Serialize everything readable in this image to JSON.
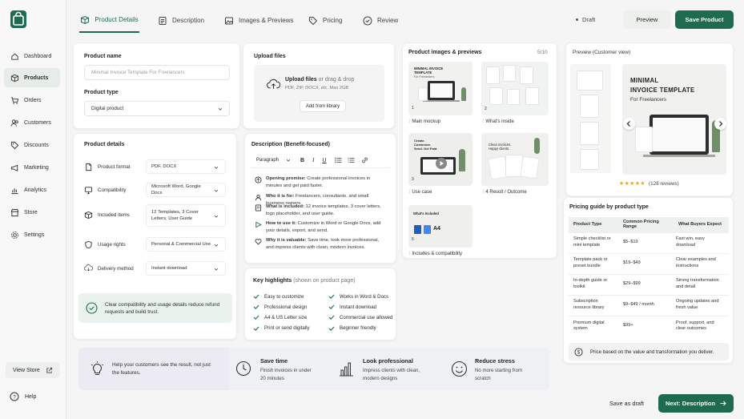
{
  "sidebar": {
    "items": [
      {
        "label": "Dashboard",
        "icon": "home-icon"
      },
      {
        "label": "Products",
        "icon": "box-icon",
        "active": true
      },
      {
        "label": "Orders",
        "icon": "cart-icon"
      },
      {
        "label": "Customers",
        "icon": "users-icon"
      },
      {
        "label": "Discounts",
        "icon": "tag-icon"
      },
      {
        "label": "Marketing",
        "icon": "megaphone-icon"
      },
      {
        "label": "Analytics",
        "icon": "chart-icon"
      },
      {
        "label": "Store",
        "icon": "store-icon"
      },
      {
        "label": "Settings",
        "icon": "gear-icon"
      }
    ],
    "view_store": "View Store",
    "help": "Help"
  },
  "tabs": [
    "Product Details",
    "Description",
    "Images & Previews",
    "Pricing",
    "Review"
  ],
  "status": "Draft",
  "preview_button": "Preview",
  "save_button": "Save Product",
  "product": {
    "name_label": "Product name",
    "name_placeholder": "Minimal Invoice Template For Freelancers",
    "type_label": "Product type",
    "type_value": "Digital product"
  },
  "upload": {
    "title": "Upload files",
    "main": "Upload files",
    "or": "or drag & drop",
    "formats": "PDF, ZIP, DOCX, etc. Max 2GB",
    "library_button": "Add from library"
  },
  "details": {
    "title": "Product details",
    "rows": [
      {
        "label": "Product format",
        "value": "PDF, DOCX"
      },
      {
        "label": "Compatibility",
        "value": "Microsoft Word, Google Docs"
      },
      {
        "label": "Included items",
        "value": "12 Templates, 3 Cover Letters, User Guide"
      },
      {
        "label": "Usage rights",
        "value": "Personal & Commercial Use"
      },
      {
        "label": "Delivery method",
        "value": "Instant download"
      }
    ],
    "note": "Clear compatibility and usage details reduce refund requests and build trust."
  },
  "description": {
    "title": "Description (Benefit-focused)",
    "style": "Paragraph",
    "items": [
      {
        "bold": "Opening promise:",
        "text": "Create professional invoices in minutes and get paid faster."
      },
      {
        "bold": "Who it is for:",
        "text": "Freelancers, consultants, and small business owners."
      },
      {
        "bold": "What is included:",
        "text": "12 invoice templates, 3 cover letters, logo placeholder, and user guide."
      },
      {
        "bold": "How to use it:",
        "text": "Customize in Word or Google Docs, add your details, export, and send."
      },
      {
        "bold": "Why it is valuable:",
        "text": "Save time, look more professional, and impress clients with clean, modern invoices."
      }
    ]
  },
  "highlights": {
    "title": "Key highlights",
    "subtitle": "(shown on product page)",
    "items": [
      "Easy to customize",
      "Works in Word & Docs",
      "Professional design",
      "Instant download",
      "A4 & US Letter size",
      "Commercial use allowed",
      "Print or send digitally",
      "Beginner friendly"
    ]
  },
  "images": {
    "title": "Product images & previews",
    "count": "5/10",
    "tiles": [
      {
        "num": "1",
        "caption": "Main mockup",
        "heading": "MINIMAL INVOICE TEMPLATE",
        "sub": "For Freelancers"
      },
      {
        "num": "2",
        "caption": "What's inside"
      },
      {
        "num": "3",
        "caption": "Use case",
        "heading": "Create. Customize. Send. Get Paid."
      },
      {
        "num": "4",
        "caption": "Result / Outcome",
        "heading": "Clean invoices. Happy clients."
      },
      {
        "num": "5",
        "caption": "Includes & compatibility",
        "heading": "What's Included"
      }
    ]
  },
  "preview": {
    "title": "Preview (Customer view)",
    "heading1": "MINIMAL",
    "heading2": "INVOICE TEMPLATE",
    "sub": "For Freelancers",
    "reviews": "(128 reviews)",
    "rating": 4.5
  },
  "pricing": {
    "title": "Pricing guide by product type",
    "headers": [
      "Product Type",
      "Common Pricing Range",
      "What Buyers Expect"
    ],
    "rows": [
      [
        "Simple checklist or mini template",
        "$5–$19",
        "Fast win, easy download"
      ],
      [
        "Template pack or preset bundle",
        "$19–$49",
        "Clear examples and instructions"
      ],
      [
        "In-depth guide or toolkit",
        "$29–$99",
        "Strong transformation and detail"
      ],
      [
        "Subscription resource library",
        "$9–$49 / month",
        "Ongoing updates and fresh value"
      ],
      [
        "Premium digital system",
        "$99+",
        "Proof, support, and clear outcomes"
      ]
    ],
    "note": "Price based on the value and transformation you deliver."
  },
  "footer": {
    "prompt": "Help your customers see the result, not just the features.",
    "benefits": [
      {
        "title": "Save time",
        "text": "Finish invoices in under 20 minutes"
      },
      {
        "title": "Look professional",
        "text": "Impress clients with clean, modern designs"
      },
      {
        "title": "Reduce stress",
        "text": "No more starting from scratch"
      }
    ],
    "save_draft": "Save as draft",
    "next": "Next: Description"
  }
}
